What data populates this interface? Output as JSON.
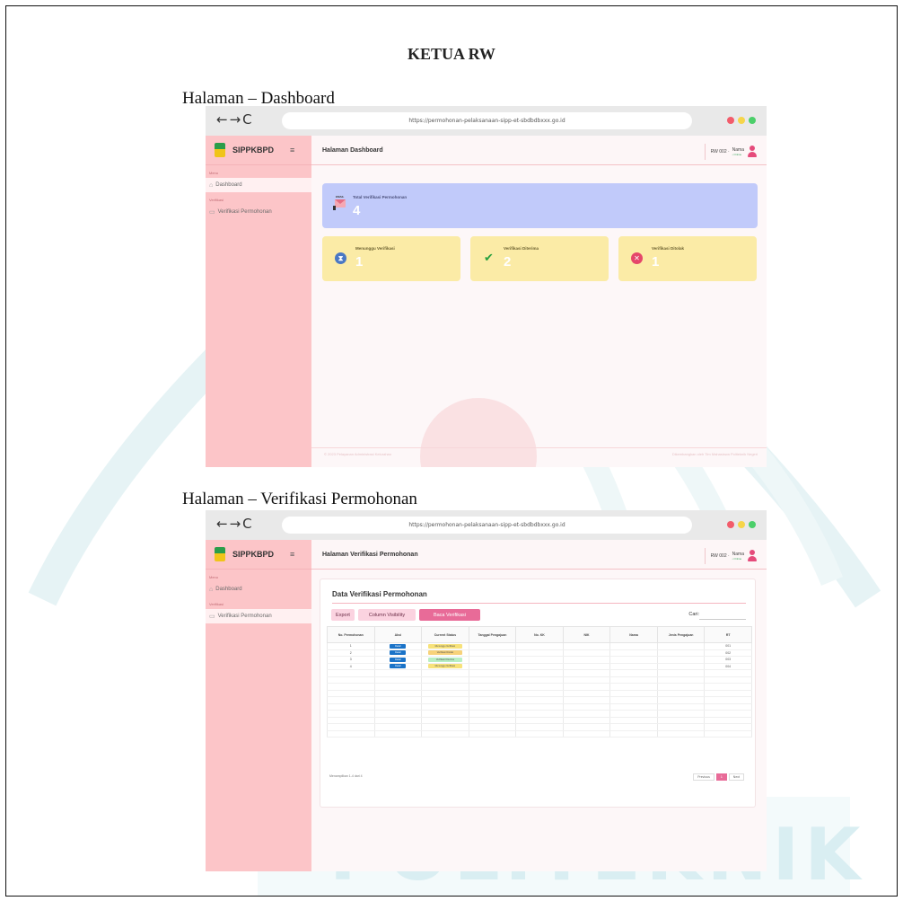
{
  "document": {
    "title": "KETUA RW",
    "watermark": "POLITEKNIK"
  },
  "dashboard": {
    "caption": "Halaman – Dashboard",
    "browser": {
      "url": "https://permohonan-pelaksanaan-sipp-et-sbdbdbxxx.go.id",
      "nav": "←→C"
    },
    "brand": "SIPPKBPD",
    "sidebar": {
      "section_main": "Menu",
      "dashboard": "Dashboard",
      "section_verif": "Verifikasi",
      "verifikasi": "Verifikasi Permohonan"
    },
    "header": {
      "title": "Halaman Dashboard",
      "role": "RW 002 ·",
      "user": "Nama",
      "status": "• Online"
    },
    "cards": {
      "total_label": "Total Verifikasi Permohonan",
      "total_value": "4",
      "envelope_tag": "EMAIL",
      "waiting_label": "Menunggu Verifikasi",
      "waiting_value": "1",
      "accepted_label": "Verifikasi Diterima",
      "accepted_value": "2",
      "rejected_label": "Verifikasi Ditolak",
      "rejected_value": "1"
    },
    "footer": {
      "left": "© 2023 Pelayanan Administrasi Kelurahan",
      "right": "Dikembangkan oleh Tim Mahasiswa Politeknik Negeri"
    }
  },
  "verifikasi": {
    "caption": "Halaman – Verifikasi Permohonan",
    "browser": {
      "url": "https://permohonan-pelaksanaan-sipp-et-sbdbdbxxx.go.id",
      "nav": "←→C"
    },
    "brand": "SIPPKBPD",
    "sidebar": {
      "section_main": "Menu",
      "dashboard": "Dashboard",
      "section_verif": "Verifikasi",
      "verifikasi": "Verifikasi Permohonan"
    },
    "header": {
      "title": "Halaman Verifikasi Permohonan",
      "role": "RW 002 ·",
      "user": "Nama",
      "status": "• Online"
    },
    "panel": {
      "title": "Data Verifikasi Permohonan",
      "export": "Export",
      "column_visibility": "Column Visibility",
      "third_button": "Baca Verifikasi",
      "search_label": "Cari:",
      "columns": [
        "No. Permohonan",
        "Aksi",
        "Current Status",
        "Tanggal Pengajuan",
        "No. KK",
        "NIK",
        "Nama",
        "Jenis Pengajuan",
        "RT"
      ],
      "rows": [
        {
          "no": "1",
          "aksi": "Detail",
          "status": "Menunggu Verifikasi",
          "status_color": "#f7e27a",
          "rt": "001"
        },
        {
          "no": "2",
          "aksi": "Detail",
          "status": "Verifikasi Ditolak",
          "status_color": "#f7d27a",
          "rt": "002"
        },
        {
          "no": "3",
          "aksi": "Detail",
          "status": "Verifikasi Diterima",
          "status_color": "#b8efc4",
          "rt": "003"
        },
        {
          "no": "4",
          "aksi": "Detail",
          "status": "Menunggu Verifikasi",
          "status_color": "#f7e27a",
          "rt": "004"
        }
      ],
      "footer_info": "Menampilkan 1-4 dari 4",
      "pager_prev": "Previous",
      "pager_page": "1",
      "pager_next": "Next"
    }
  },
  "colors": {
    "sidebar": "#fcc5c8",
    "total_card": "#c1cafa",
    "status_card": "#fbeba6",
    "accent_pink": "#e54b7b",
    "waiting_icon": "#4a78c4",
    "accepted_icon": "#27a03e",
    "rejected_icon": "#e5466a"
  }
}
